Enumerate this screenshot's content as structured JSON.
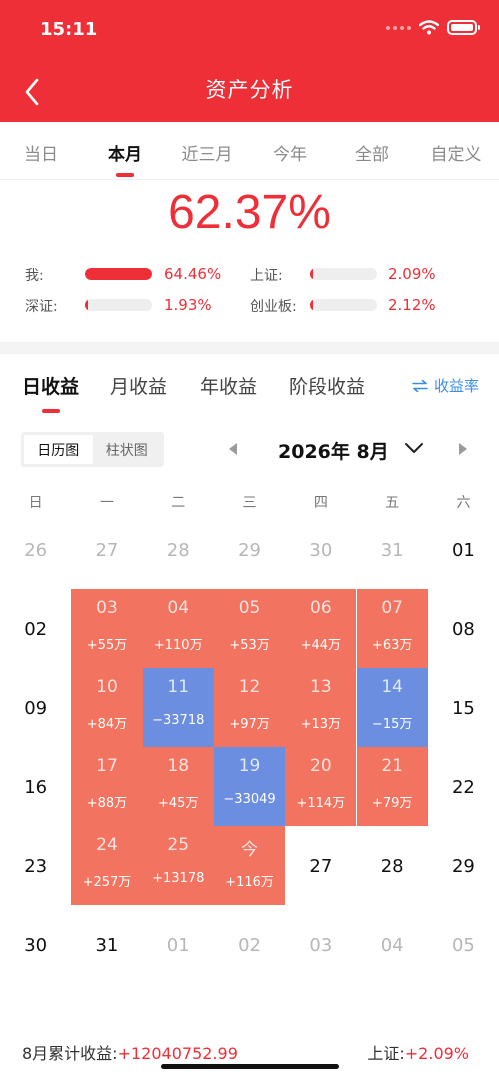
{
  "status_bar": {
    "time": "15:11"
  },
  "header": {
    "title": "资产分析"
  },
  "period_tabs": [
    {
      "label": "当日"
    },
    {
      "label": "本月"
    },
    {
      "label": "近三月"
    },
    {
      "label": "今年"
    },
    {
      "label": "全部"
    },
    {
      "label": "自定义"
    }
  ],
  "active_period": "本月",
  "summary": {
    "return_pct": "62.37%"
  },
  "comparisons": [
    {
      "label": "我:",
      "value": "64.46%",
      "fill": 1.0
    },
    {
      "label": "上证:",
      "value": "2.09%",
      "fill": 0.03
    },
    {
      "label": "深证:",
      "value": "1.93%",
      "fill": 0.03
    },
    {
      "label": "创业板:",
      "value": "2.12%",
      "fill": 0.03
    }
  ],
  "profit_tabs": [
    {
      "label": "日收益"
    },
    {
      "label": "月收益"
    },
    {
      "label": "年收益"
    },
    {
      "label": "阶段收益"
    }
  ],
  "rate_toggle": {
    "icon": "swap-icon",
    "label": "收益率"
  },
  "view_switch": {
    "options": [
      "日历图",
      "柱状图"
    ],
    "active": "日历图"
  },
  "month_nav": {
    "label": "2026年 8月"
  },
  "weekdays": [
    "日",
    "一",
    "二",
    "三",
    "四",
    "五",
    "六"
  ],
  "calendar_weeks": [
    [
      {
        "day": "26",
        "type": "other"
      },
      {
        "day": "27",
        "type": "other"
      },
      {
        "day": "28",
        "type": "other"
      },
      {
        "day": "29",
        "type": "other"
      },
      {
        "day": "30",
        "type": "other"
      },
      {
        "day": "31",
        "type": "other"
      },
      {
        "day": "01",
        "type": "plain"
      }
    ],
    [
      {
        "day": "02",
        "type": "plain"
      },
      {
        "day": "03",
        "type": "profit",
        "value": "+55万"
      },
      {
        "day": "04",
        "type": "profit",
        "value": "+110万"
      },
      {
        "day": "05",
        "type": "profit",
        "value": "+53万"
      },
      {
        "day": "06",
        "type": "profit",
        "value": "+44万"
      },
      {
        "day": "07",
        "type": "profit",
        "value": "+63万"
      },
      {
        "day": "08",
        "type": "plain"
      }
    ],
    [
      {
        "day": "09",
        "type": "plain"
      },
      {
        "day": "10",
        "type": "profit",
        "value": "+84万"
      },
      {
        "day": "11",
        "type": "loss",
        "value": "−33718"
      },
      {
        "day": "12",
        "type": "profit",
        "value": "+97万"
      },
      {
        "day": "13",
        "type": "profit",
        "value": "+13万"
      },
      {
        "day": "14",
        "type": "loss",
        "value": "−15万"
      },
      {
        "day": "15",
        "type": "plain"
      }
    ],
    [
      {
        "day": "16",
        "type": "plain"
      },
      {
        "day": "17",
        "type": "profit",
        "value": "+88万"
      },
      {
        "day": "18",
        "type": "profit",
        "value": "+45万"
      },
      {
        "day": "19",
        "type": "loss",
        "value": "−33049"
      },
      {
        "day": "20",
        "type": "profit",
        "value": "+114万"
      },
      {
        "day": "21",
        "type": "profit",
        "value": "+79万"
      },
      {
        "day": "22",
        "type": "plain"
      }
    ],
    [
      {
        "day": "23",
        "type": "plain"
      },
      {
        "day": "24",
        "type": "profit",
        "value": "+257万"
      },
      {
        "day": "25",
        "type": "profit",
        "value": "+13178"
      },
      {
        "day": "今",
        "type": "profit",
        "value": "+116万"
      },
      {
        "day": "27",
        "type": "plain"
      },
      {
        "day": "28",
        "type": "plain"
      },
      {
        "day": "29",
        "type": "plain"
      }
    ],
    [
      {
        "day": "30",
        "type": "plain"
      },
      {
        "day": "31",
        "type": "plain"
      },
      {
        "day": "01",
        "type": "other"
      },
      {
        "day": "02",
        "type": "other"
      },
      {
        "day": "03",
        "type": "other"
      },
      {
        "day": "04",
        "type": "other"
      },
      {
        "day": "05",
        "type": "other"
      }
    ]
  ],
  "footer": {
    "cumulative_label": "8月累计收益:",
    "cumulative_value": "+12040752.99",
    "index_label": "上证:",
    "index_value": "+2.09%"
  },
  "colors": {
    "brand_red": "#ee2f38",
    "profit_cell": "#f27360",
    "loss_cell": "#6b8ee0",
    "link_blue": "#3a8ee6"
  }
}
